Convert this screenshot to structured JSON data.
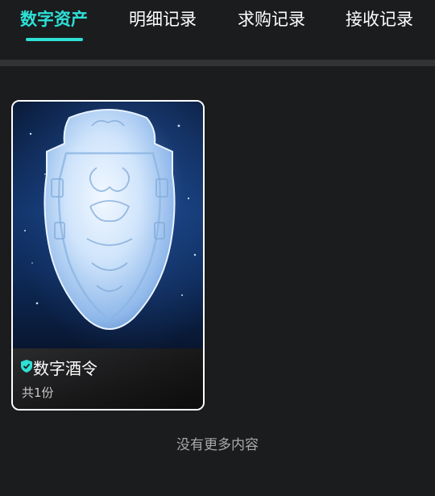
{
  "tabs": [
    {
      "label": "数字资产",
      "active": true
    },
    {
      "label": "明细记录",
      "active": false
    },
    {
      "label": "求购记录",
      "active": false
    },
    {
      "label": "接收记录",
      "active": false
    }
  ],
  "asset": {
    "name": "数字酒令",
    "count": "共1份",
    "badge_icon": "shield-check-icon",
    "image": "jade-token-image"
  },
  "footer": {
    "end_text": "没有更多内容"
  },
  "colors": {
    "accent": "#2ee0d6",
    "background": "#1b1c1e",
    "divider": "#323335"
  }
}
